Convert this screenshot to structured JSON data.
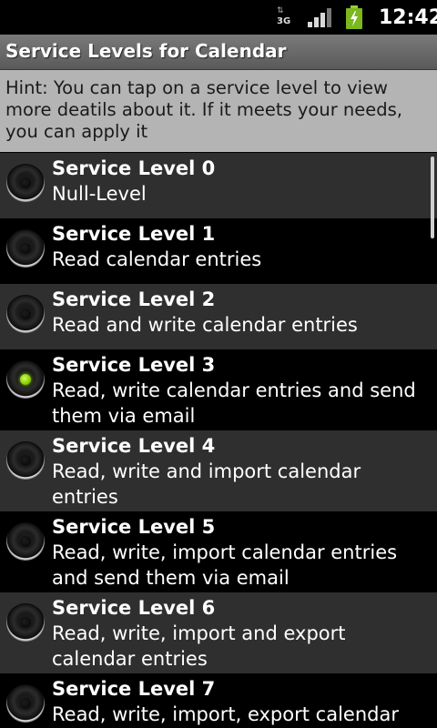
{
  "status_bar": {
    "network": "3G",
    "time": "12:42",
    "signal_icon": "signal-strength-icon",
    "battery_icon": "battery-charging-icon"
  },
  "title": "Service Levels for Calendar",
  "hint": "Hint: You can tap on a service level to view more deatils about it. If it meets your needs, you can apply it",
  "service_levels": [
    {
      "title": "Service Level 0",
      "description": "Null-Level",
      "selected": false
    },
    {
      "title": "Service Level 1",
      "description": "Read calendar entries",
      "selected": false
    },
    {
      "title": "Service Level 2",
      "description": "Read and write calendar entries",
      "selected": false
    },
    {
      "title": "Service Level 3",
      "description": "Read, write calendar entries and send them via email",
      "selected": true
    },
    {
      "title": "Service Level 4",
      "description": "Read, write and import calendar entries",
      "selected": false
    },
    {
      "title": "Service Level 5",
      "description": "Read, write, import calendar entries and send them via email",
      "selected": false
    },
    {
      "title": "Service Level 6",
      "description": "Read, write, import and export calendar entries",
      "selected": false
    },
    {
      "title": "Service Level 7",
      "description": "Read, write, import, export calendar",
      "selected": false
    }
  ],
  "colors": {
    "selected_radio": "#8acd00",
    "row_odd": "#2f2f2f",
    "row_even": "#000000",
    "hint_background": "#b4b4b4"
  }
}
